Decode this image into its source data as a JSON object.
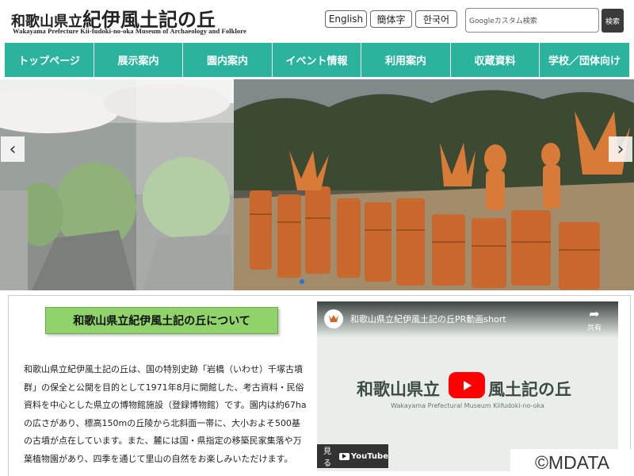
{
  "header": {
    "logo_prefix": "和歌山県立",
    "logo_main": "紀伊風土記の丘",
    "logo_subtitle": "Wakayama Prefecture Kii-fudoki-no-oka Museum of Archaeology and Folklore",
    "languages": [
      "English",
      "簡体字",
      "한국어"
    ],
    "search_placeholder": "Googleカスタム検索",
    "search_button": "検索"
  },
  "nav": {
    "items": [
      "トップページ",
      "展示案内",
      "園内案内",
      "イベント情報",
      "利用案内",
      "収蔵資料",
      "学校／団体向け"
    ]
  },
  "slider": {
    "prev": "‹",
    "next": "›"
  },
  "about": {
    "title": "和歌山県立紀伊風土記の丘について",
    "lines": [
      "和歌山県立紀伊風土記の丘は、国の特別史跡「岩橋（いわせ）千塚古墳",
      "群」の保全と公開を目的として1971年8月に開館した、考古資料・民俗",
      "資料を中心とした県立の博物館施設（登録博物館）です。園内は約67ha",
      "の広さがあり、標高150mの丘陵から北斜面一帯に、大小およそ500基",
      "の古墳が点在しています。また、麓には国・県指定の移築民家集落や万",
      "葉植物園があり、四季を通じて里山の自然をお楽しみいただけます。"
    ]
  },
  "video": {
    "title": "和歌山県立紀伊風土記の丘PR動画short",
    "share_label": "共有",
    "caption_left": "和歌山県立",
    "caption_right": "風土記の丘",
    "caption_sub": "Wakayama Prefectural Museum Kiifudoki-no-oka",
    "watch_label": "見る",
    "youtube_label": "YouTube"
  },
  "copyright": "©MDATA"
}
